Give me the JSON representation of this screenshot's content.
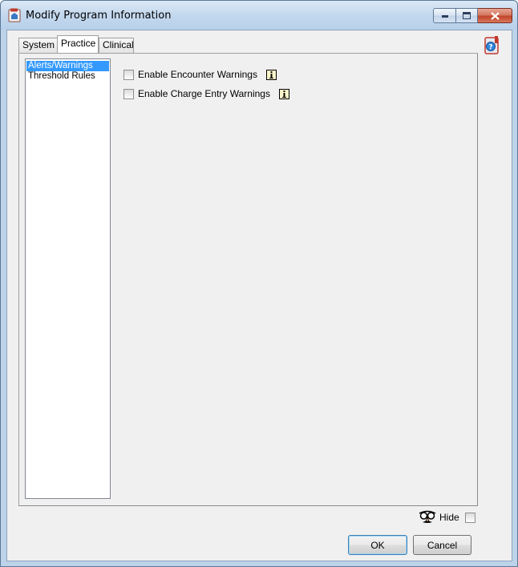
{
  "window": {
    "title": "Modify Program Information",
    "icon": "app-icon"
  },
  "tabs": [
    {
      "label": "System",
      "active": false
    },
    {
      "label": "Practice",
      "active": true
    },
    {
      "label": "Clinical",
      "active": false
    }
  ],
  "nav": {
    "items": [
      {
        "label": "Alerts/Warnings",
        "selected": true
      },
      {
        "label": "Threshold Rules",
        "selected": false
      }
    ]
  },
  "settings": {
    "encounter_warnings": {
      "label": "Enable Encounter Warnings",
      "checked": false
    },
    "charge_entry_warnings": {
      "label": "Enable Charge Entry Warnings",
      "checked": false
    }
  },
  "footer": {
    "hide_label": "Hide",
    "hide_checked": false,
    "ok_label": "OK",
    "cancel_label": "Cancel"
  },
  "colors": {
    "selection": "#3399ff",
    "frame": "#bcd3ea",
    "close_button": "#c2442a"
  }
}
